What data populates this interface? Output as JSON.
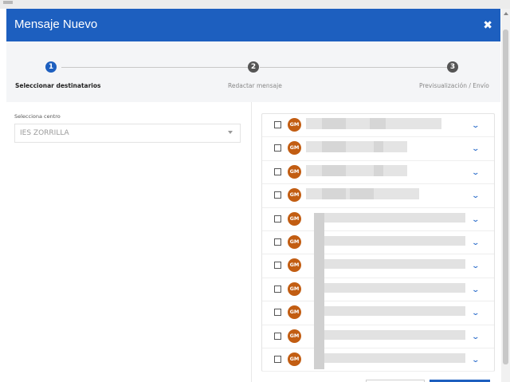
{
  "modal": {
    "title": "Mensaje Nuevo",
    "close_icon": "close-icon"
  },
  "stepper": {
    "steps": [
      {
        "number": "1",
        "label": "Seleccionar destinatarios",
        "active": true
      },
      {
        "number": "2",
        "label": "Redactar mensaje",
        "active": false
      },
      {
        "number": "3",
        "label": "Previsualización / Envío",
        "active": false
      }
    ]
  },
  "centro": {
    "label": "Selecciona centro",
    "value": "IES ZORRILLA"
  },
  "recipients": {
    "items": [
      {
        "initials": "GM"
      },
      {
        "initials": "GM"
      },
      {
        "initials": "GM"
      },
      {
        "initials": "GM"
      },
      {
        "initials": "GM"
      },
      {
        "initials": "GM"
      },
      {
        "initials": "GM"
      },
      {
        "initials": "GM"
      },
      {
        "initials": "GM"
      },
      {
        "initials": "GM"
      },
      {
        "initials": "GM"
      }
    ]
  },
  "colors": {
    "primary": "#1d5fbf",
    "avatar": "#c25d12",
    "stepper_bg": "#f4f5f7"
  }
}
